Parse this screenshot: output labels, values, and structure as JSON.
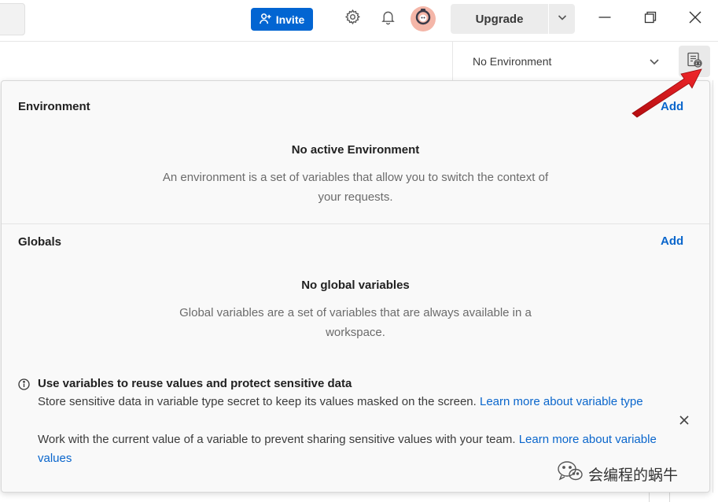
{
  "titlebar": {
    "invite_label": "Invite",
    "upgrade_label": "Upgrade"
  },
  "env_selector": {
    "selected": "No Environment"
  },
  "environment": {
    "heading": "Environment",
    "add_label": "Add",
    "empty_title": "No active Environment",
    "empty_desc": "An environment is a set of variables that allow you to switch the context of your requests."
  },
  "globals": {
    "heading": "Globals",
    "add_label": "Add",
    "empty_title": "No global variables",
    "empty_desc": "Global variables are a set of variables that are always available in a workspace."
  },
  "info": {
    "title": "Use variables to reuse values and protect sensitive data",
    "line1": "Store sensitive data in variable type secret to keep its values masked on the screen.",
    "line1_link": "Learn more about variable type",
    "line2": "Work with the current value of a variable to prevent sharing sensitive values with your team.",
    "line2_link": "Learn more about variable values"
  },
  "watermark": {
    "text": "会编程的蜗牛"
  },
  "colors": {
    "brand_blue": "#0265d2",
    "link_blue": "#0a66cc",
    "annotation_red": "#e8171b"
  },
  "icons": [
    "add-user-icon",
    "gear-icon",
    "bell-icon",
    "avatar-icon",
    "chevron-down-icon",
    "minimize-icon",
    "restore-icon",
    "close-icon",
    "env-quicklook-icon",
    "info-icon",
    "dismiss-icon",
    "wechat-icon"
  ]
}
